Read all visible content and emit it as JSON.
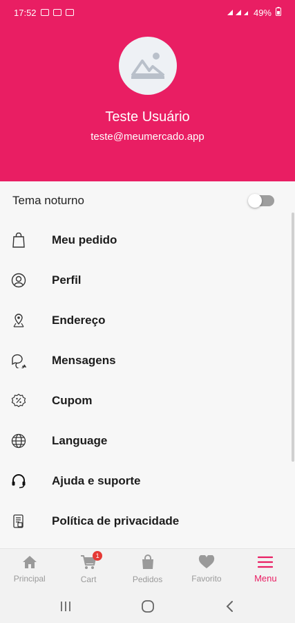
{
  "status_bar": {
    "time": "17:52",
    "battery": "49%"
  },
  "profile": {
    "name": "Teste Usuário",
    "email": "teste@meumercado.app"
  },
  "theme_toggle": {
    "label": "Tema noturno",
    "enabled": false
  },
  "menu": {
    "items": [
      {
        "label": "Meu pedido",
        "icon": "shopping-bag-icon"
      },
      {
        "label": "Perfil",
        "icon": "user-circle-icon"
      },
      {
        "label": "Endereço",
        "icon": "map-pin-icon"
      },
      {
        "label": "Mensagens",
        "icon": "chat-bubbles-icon"
      },
      {
        "label": "Cupom",
        "icon": "coupon-icon"
      },
      {
        "label": "Language",
        "icon": "globe-icon"
      },
      {
        "label": "Ajuda e suporte",
        "icon": "headset-icon"
      },
      {
        "label": "Política de privacidade",
        "icon": "document-icon"
      }
    ]
  },
  "bottom_nav": {
    "items": [
      {
        "label": "Principal",
        "icon": "home-icon"
      },
      {
        "label": "Cart",
        "icon": "cart-icon",
        "badge": "1"
      },
      {
        "label": "Pedidos",
        "icon": "bag-icon"
      },
      {
        "label": "Favorito",
        "icon": "heart-icon"
      },
      {
        "label": "Menu",
        "icon": "hamburger-icon",
        "active": true
      }
    ]
  },
  "colors": {
    "brand": "#e91e63",
    "inactive": "#9a9a9a",
    "badge": "#e53935"
  }
}
